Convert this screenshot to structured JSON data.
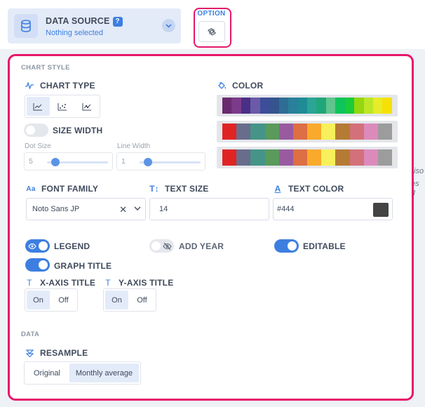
{
  "datasource": {
    "title": "DATA SOURCE",
    "help": "?",
    "subtitle": "Nothing selected",
    "icon": "database-icon"
  },
  "option": {
    "label": "OPTION",
    "icon": "gear-icon"
  },
  "chart_style": {
    "section_label": "CHART STYLE",
    "chart_type": {
      "label": "CHART TYPE",
      "options": [
        "line",
        "scatter",
        "line-with-points"
      ],
      "selected": "line"
    },
    "size_width": {
      "label": "SIZE WIDTH",
      "on": false
    },
    "dot_size": {
      "label": "Dot Size",
      "value": "5"
    },
    "line_width": {
      "label": "Line Width",
      "value": "1"
    },
    "color": {
      "label": "COLOR",
      "palettes": [
        [
          "#6b2a6e",
          "#7c3a8a",
          "#4a2f86",
          "#6b5aa8",
          "#3e4d9a",
          "#34548e",
          "#2f6d95",
          "#2a7f9a",
          "#1f8c95",
          "#2aa596",
          "#20a779",
          "#5fc48d",
          "#0fc35b",
          "#1acb3a",
          "#93d70f",
          "#bde626",
          "#e7ec28",
          "#f5e106"
        ],
        [
          "#e02424",
          "#686d8c",
          "#459487",
          "#5a9a5a",
          "#9a5aa0",
          "#de6e43",
          "#f9aa2b",
          "#f7f05a",
          "#b57b34",
          "#d3717a",
          "#dc8abb",
          "#9c9c9c"
        ],
        [
          "#e02424",
          "#686d8c",
          "#459487",
          "#5a9a5a",
          "#9a5aa0",
          "#de6e43",
          "#f9aa2b",
          "#f7f05a",
          "#b57b34",
          "#d3717a",
          "#dc8abb",
          "#9c9c9c"
        ]
      ]
    },
    "font_family": {
      "label": "FONT FAMILY",
      "value": "Noto Sans JP"
    },
    "text_size": {
      "label": "TEXT SIZE",
      "value": "14"
    },
    "text_color": {
      "label": "TEXT COLOR",
      "value": "#444",
      "swatch": "#444444"
    },
    "legend": {
      "label": "LEGEND",
      "on": true
    },
    "add_year": {
      "label": "ADD YEAR",
      "on": false
    },
    "editable": {
      "label": "EDITABLE",
      "on": true
    },
    "graph_title": {
      "label": "GRAPH TITLE",
      "on": true
    },
    "x_axis_title": {
      "label": "X-AXIS TITLE",
      "on_label": "On",
      "off_label": "Off",
      "selected": "On"
    },
    "y_axis_title": {
      "label": "Y-AXIS TITLE",
      "on_label": "On",
      "off_label": "Off",
      "selected": "On"
    }
  },
  "data_section": {
    "section_label": "DATA",
    "resample": {
      "label": "RESAMPLE",
      "options": [
        "Original",
        "Monthly average"
      ],
      "selected": "Monthly average"
    }
  },
  "background_fragments": [
    "iso",
    "es g"
  ],
  "accent": "#3d7fe0",
  "highlight": "#e6176b"
}
